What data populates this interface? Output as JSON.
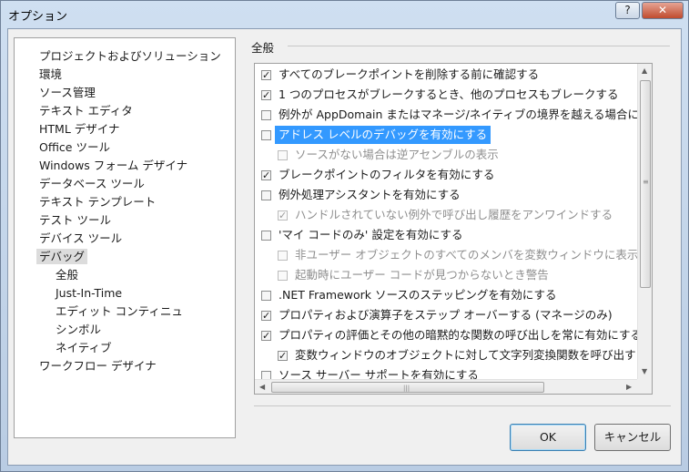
{
  "window": {
    "title": "オプション",
    "help_label": "?",
    "close_label": "✕"
  },
  "tree": {
    "items": [
      {
        "label": "プロジェクトおよびソリューション",
        "level": 0
      },
      {
        "label": "環境",
        "level": 0
      },
      {
        "label": "ソース管理",
        "level": 0
      },
      {
        "label": "テキスト エディタ",
        "level": 0
      },
      {
        "label": "HTML デザイナ",
        "level": 0
      },
      {
        "label": "Office ツール",
        "level": 0
      },
      {
        "label": "Windows フォーム デザイナ",
        "level": 0
      },
      {
        "label": "データベース ツール",
        "level": 0
      },
      {
        "label": "テキスト テンプレート",
        "level": 0
      },
      {
        "label": "テスト ツール",
        "level": 0
      },
      {
        "label": "デバイス ツール",
        "level": 0
      },
      {
        "label": "デバッグ",
        "level": 0,
        "selected": true
      },
      {
        "label": "全般",
        "level": 1
      },
      {
        "label": "Just-In-Time",
        "level": 1
      },
      {
        "label": "エディット コンティニュ",
        "level": 1
      },
      {
        "label": "シンボル",
        "level": 1
      },
      {
        "label": "ネイティブ",
        "level": 1
      },
      {
        "label": "ワークフロー デザイナ",
        "level": 0
      }
    ]
  },
  "section": {
    "title": "全般"
  },
  "options": [
    {
      "label": "すべてのブレークポイントを削除する前に確認する",
      "checked": true,
      "indent": 0
    },
    {
      "label": "1 つのプロセスがブレークするとき、他のプロセスもブレークする",
      "checked": true,
      "indent": 0
    },
    {
      "label": "例外が AppDomain またはマネージ/ネイティブの境界を越える場合にブ",
      "checked": false,
      "indent": 0
    },
    {
      "label": "アドレス レベルのデバッグを有効にする",
      "checked": false,
      "indent": 0,
      "highlight": true
    },
    {
      "label": "ソースがない場合は逆アセンブルの表示",
      "checked": false,
      "indent": 1,
      "disabled": true
    },
    {
      "label": "ブレークポイントのフィルタを有効にする",
      "checked": true,
      "indent": 0
    },
    {
      "label": "例外処理アシスタントを有効にする",
      "checked": false,
      "indent": 0
    },
    {
      "label": "ハンドルされていない例外で呼び出し履歴をアンワインドする",
      "checked": true,
      "indent": 1,
      "disabled": true
    },
    {
      "label": "'マイ コードのみ' 設定を有効にする",
      "checked": false,
      "indent": 0
    },
    {
      "label": "非ユーザー オブジェクトのすべてのメンバを変数ウィンドウに表示す",
      "checked": false,
      "indent": 1,
      "disabled": true
    },
    {
      "label": "起動時にユーザー コードが見つからないとき警告",
      "checked": false,
      "indent": 1,
      "disabled": true
    },
    {
      "label": ".NET Framework ソースのステッピングを有効にする",
      "checked": false,
      "indent": 0
    },
    {
      "label": "プロパティおよび演算子をステップ オーバーする (マネージのみ)",
      "checked": true,
      "indent": 0
    },
    {
      "label": "プロパティの評価とその他の暗黙的な関数の呼び出しを常に有効にする",
      "checked": true,
      "indent": 0
    },
    {
      "label": "変数ウィンドウのオブジェクトに対して文字列変換関数を呼び出す (C",
      "checked": true,
      "indent": 1
    },
    {
      "label": "ソース サーバー サポートを有効にする",
      "checked": false,
      "indent": 0
    }
  ],
  "scrollbar": {
    "up": "▲",
    "down": "▼",
    "left": "◀",
    "right": "▶",
    "grip": "≡",
    "hgrip": "|||"
  },
  "buttons": {
    "ok": "OK",
    "cancel": "キャンセル"
  }
}
